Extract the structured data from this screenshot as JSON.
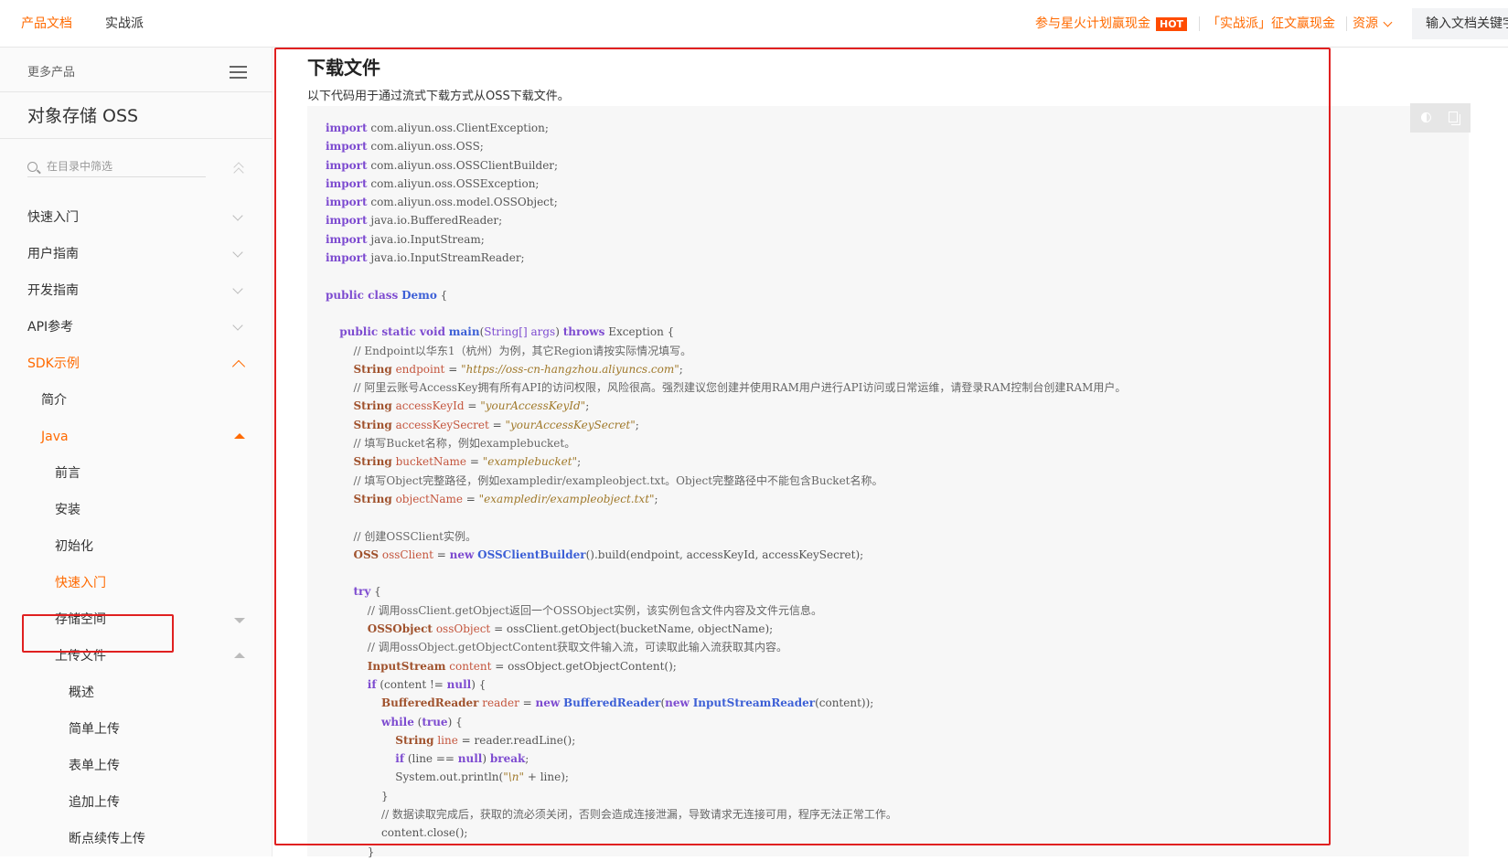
{
  "topbar": {
    "tabs": [
      "产品文档",
      "实战派"
    ],
    "promo1": "参与星火计划赢现金",
    "hot_badge": "HOT",
    "promo2": "「实战派」征文赢现金",
    "resources": "资源",
    "search_placeholder": "输入文档关键字"
  },
  "sidebar": {
    "more_products": "更多产品",
    "product_title": "对象存储 OSS",
    "filter_placeholder": "在目录中筛选",
    "items": [
      {
        "label": "快速入门"
      },
      {
        "label": "用户指南"
      },
      {
        "label": "开发指南"
      },
      {
        "label": "API参考"
      },
      {
        "label": "SDK示例"
      },
      {
        "label": "简介"
      },
      {
        "label": "Java"
      },
      {
        "label": "前言"
      },
      {
        "label": "安装"
      },
      {
        "label": "初始化"
      },
      {
        "label": "快速入门"
      },
      {
        "label": "存储空间"
      },
      {
        "label": "上传文件"
      },
      {
        "label": "概述"
      },
      {
        "label": "简单上传"
      },
      {
        "label": "表单上传"
      },
      {
        "label": "追加上传"
      },
      {
        "label": "断点续传上传"
      }
    ]
  },
  "content": {
    "heading": "下载文件",
    "intro": "以下代码用于通过流式下载方式从OSS下载文件。",
    "code": {
      "imports": [
        "com.aliyun.oss.ClientException;",
        "com.aliyun.oss.OSS;",
        "com.aliyun.oss.OSSClientBuilder;",
        "com.aliyun.oss.OSSException;",
        "com.aliyun.oss.model.OSSObject;",
        "java.io.BufferedReader;",
        "java.io.InputStream;",
        "java.io.InputStreamReader;"
      ],
      "comment_endpoint": "// Endpoint以华东1（杭州）为例，其它Region请按实际情况填写。",
      "endpoint_value": "\"https://oss-cn-hangzhou.aliyuncs.com\"",
      "comment_accesskey": "// 阿里云账号AccessKey拥有所有API的访问权限，风险很高。强烈建议您创建并使用RAM用户进行API访问或日常运维，请登录RAM控制台创建RAM用户。",
      "access_key_id_value": "\"yourAccessKeyId\"",
      "access_key_secret_value": "\"yourAccessKeySecret\"",
      "comment_bucket": "// 填写Bucket名称，例如examplebucket。",
      "bucket_value": "\"examplebucket\"",
      "comment_object": "// 填写Object完整路径，例如exampledir/exampleobject.txt。Object完整路径中不能包含Bucket名称。",
      "object_value": "\"exampledir/exampleobject.txt\"",
      "comment_create": "// 创建OSSClient实例。",
      "comment_getobject": "// 调用ossClient.getObject返回一个OSSObject实例，该实例包含文件内容及文件元信息。",
      "comment_content": "// 调用ossObject.getObjectContent获取文件输入流，可读取此输入流获取其内容。",
      "println_arg": "\"\\n\"",
      "comment_close": "// 数据读取完成后，获取的流必须关闭，否则会造成连接泄漏，导致请求无连接可用，程序无法正常工作。"
    }
  }
}
